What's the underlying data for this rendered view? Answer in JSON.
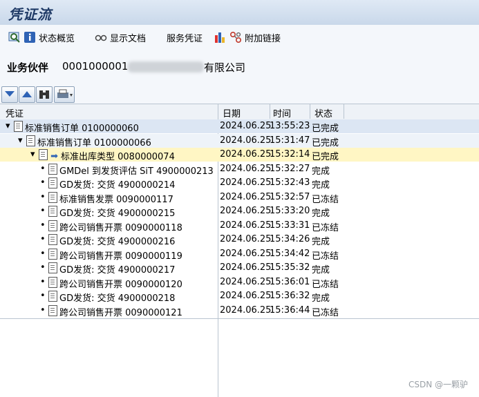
{
  "title": "凭证流",
  "toolbar": {
    "status_overview": "状态概览",
    "display_doc": "显示文档",
    "service_doc": "服务凭证",
    "attach_link": "附加链接"
  },
  "business_partner": {
    "label": "业务伙伴",
    "number": "0001000001",
    "name_suffix": "有限公司"
  },
  "columns": {
    "document": "凭证",
    "date": "日期",
    "time": "时间",
    "status": "状态"
  },
  "rows": [
    {
      "doc": "标准销售订单 0100000060",
      "date": "2024.06.25",
      "time": "13:55:23",
      "status": "已完成"
    },
    {
      "doc": "标准销售订单 0100000066",
      "date": "2024.06.25",
      "time": "15:31:47",
      "status": "已完成"
    },
    {
      "doc": "标准出库类型 0080000074",
      "date": "2024.06.25",
      "time": "15:32:14",
      "status": "已完成"
    },
    {
      "doc": "GMDel 到发货评估 SiT 4900000213",
      "date": "2024.06.25",
      "time": "15:32:27",
      "status": "完成"
    },
    {
      "doc": "GD发货: 交货 4900000214",
      "date": "2024.06.25",
      "time": "15:32:43",
      "status": "完成"
    },
    {
      "doc": "标准销售发票 0090000117",
      "date": "2024.06.25",
      "time": "15:32:57",
      "status": "已冻结"
    },
    {
      "doc": "GD发货: 交货 4900000215",
      "date": "2024.06.25",
      "time": "15:33:20",
      "status": "完成"
    },
    {
      "doc": "跨公司销售开票 0090000118",
      "date": "2024.06.25",
      "time": "15:33:31",
      "status": "已冻结"
    },
    {
      "doc": "GD发货: 交货 4900000216",
      "date": "2024.06.25",
      "time": "15:34:26",
      "status": "完成"
    },
    {
      "doc": "跨公司销售开票 0090000119",
      "date": "2024.06.25",
      "time": "15:34:42",
      "status": "已冻结"
    },
    {
      "doc": "GD发货: 交货 4900000217",
      "date": "2024.06.25",
      "time": "15:35:32",
      "status": "完成"
    },
    {
      "doc": "跨公司销售开票 0090000120",
      "date": "2024.06.25",
      "time": "15:36:01",
      "status": "已冻结"
    },
    {
      "doc": "GD发货: 交货 4900000218",
      "date": "2024.06.25",
      "time": "15:36:32",
      "status": "完成"
    },
    {
      "doc": "跨公司销售开票 0090000121",
      "date": "2024.06.25",
      "time": "15:36:44",
      "status": "已冻结"
    }
  ],
  "watermark": "CSDN @一颗驴"
}
